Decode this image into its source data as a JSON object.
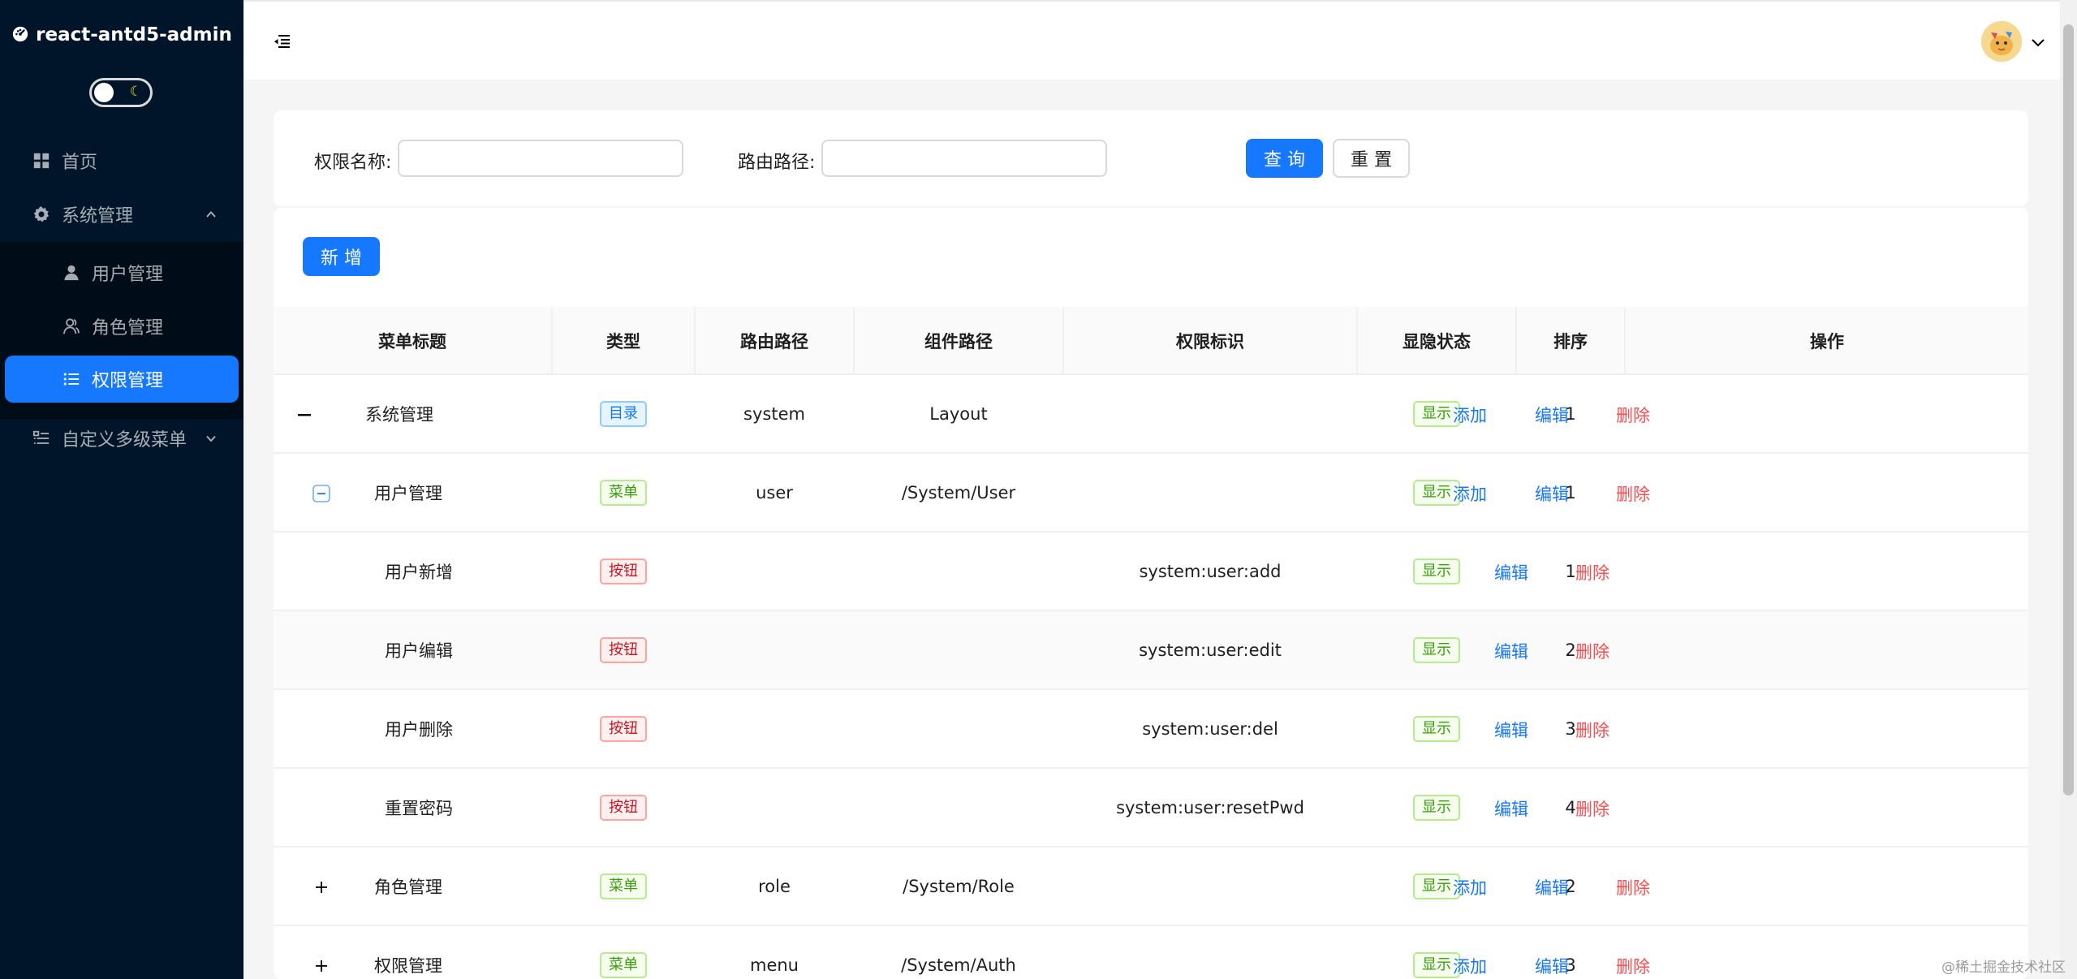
{
  "app": {
    "logo_text": "react-antd5-admin",
    "logo_icon": "dashboard-icon",
    "theme_toggle_icon": "moon-icon"
  },
  "sidebar": {
    "items": [
      {
        "label": "首页",
        "icon": "appstore-icon"
      },
      {
        "label": "系统管理",
        "icon": "setting-icon",
        "expanded": true
      },
      {
        "label": "用户管理",
        "icon": "user-icon"
      },
      {
        "label": "角色管理",
        "icon": "team-icon"
      },
      {
        "label": "权限管理",
        "icon": "unordered-list-icon",
        "active": true
      },
      {
        "label": "自定义多级菜单",
        "icon": "ordered-list-icon",
        "expanded": false
      }
    ]
  },
  "header": {
    "fold_icon": "menu-fold-icon",
    "avatar_icon": "avatar",
    "dropdown_icon": "chevron-down-icon"
  },
  "search": {
    "name_label": "权限名称:",
    "name_value": "",
    "path_label": "路由路径:",
    "path_value": "",
    "query_button": "查 询",
    "reset_button": "重 置"
  },
  "toolbar": {
    "add_button": "新 增"
  },
  "table": {
    "columns": [
      "菜单标题",
      "类型",
      "路由路径",
      "组件路径",
      "权限标识",
      "显隐状态",
      "排序",
      "操作"
    ],
    "rows": [
      {
        "title": "系统管理",
        "type": "目录",
        "type_color": "blue",
        "route": "system",
        "component": "Layout",
        "perm": "",
        "status": "显示",
        "sort": "1",
        "actions": [
          "添加",
          "编辑",
          "删除"
        ],
        "expand": "minus"
      },
      {
        "title": "用户管理",
        "type": "菜单",
        "type_color": "green",
        "route": "user",
        "component": "/System/User",
        "perm": "",
        "status": "显示",
        "sort": "1",
        "actions": [
          "添加",
          "编辑",
          "删除"
        ],
        "expand": "minus-boxed"
      },
      {
        "title": "用户新增",
        "type": "按钮",
        "type_color": "red",
        "route": "",
        "component": "",
        "perm": "system:user:add",
        "status": "显示",
        "sort": "1",
        "actions": [
          "编辑",
          "删除"
        ]
      },
      {
        "title": "用户编辑",
        "type": "按钮",
        "type_color": "red",
        "route": "",
        "component": "",
        "perm": "system:user:edit",
        "status": "显示",
        "sort": "2",
        "actions": [
          "编辑",
          "删除"
        ]
      },
      {
        "title": "用户删除",
        "type": "按钮",
        "type_color": "red",
        "route": "",
        "component": "",
        "perm": "system:user:del",
        "status": "显示",
        "sort": "3",
        "actions": [
          "编辑",
          "删除"
        ]
      },
      {
        "title": "重置密码",
        "type": "按钮",
        "type_color": "red",
        "route": "",
        "component": "",
        "perm": "system:user:resetPwd",
        "status": "显示",
        "sort": "4",
        "actions": [
          "编辑",
          "删除"
        ]
      },
      {
        "title": "角色管理",
        "type": "菜单",
        "type_color": "green",
        "route": "role",
        "component": "/System/Role",
        "perm": "",
        "status": "显示",
        "sort": "2",
        "actions": [
          "添加",
          "编辑",
          "删除"
        ],
        "expand": "plus"
      },
      {
        "title": "权限管理",
        "type": "菜单",
        "type_color": "green",
        "route": "menu",
        "component": "/System/Auth",
        "perm": "",
        "status": "显示",
        "sort": "3",
        "actions": [
          "添加",
          "编辑",
          "删除"
        ],
        "expand": "plus"
      }
    ]
  },
  "watermark": "@稀土掘金技术社区",
  "colors": {
    "primary": "#1677ff",
    "danger": "#ff4d4f",
    "sider": "#001529",
    "submenu": "#000c17"
  }
}
